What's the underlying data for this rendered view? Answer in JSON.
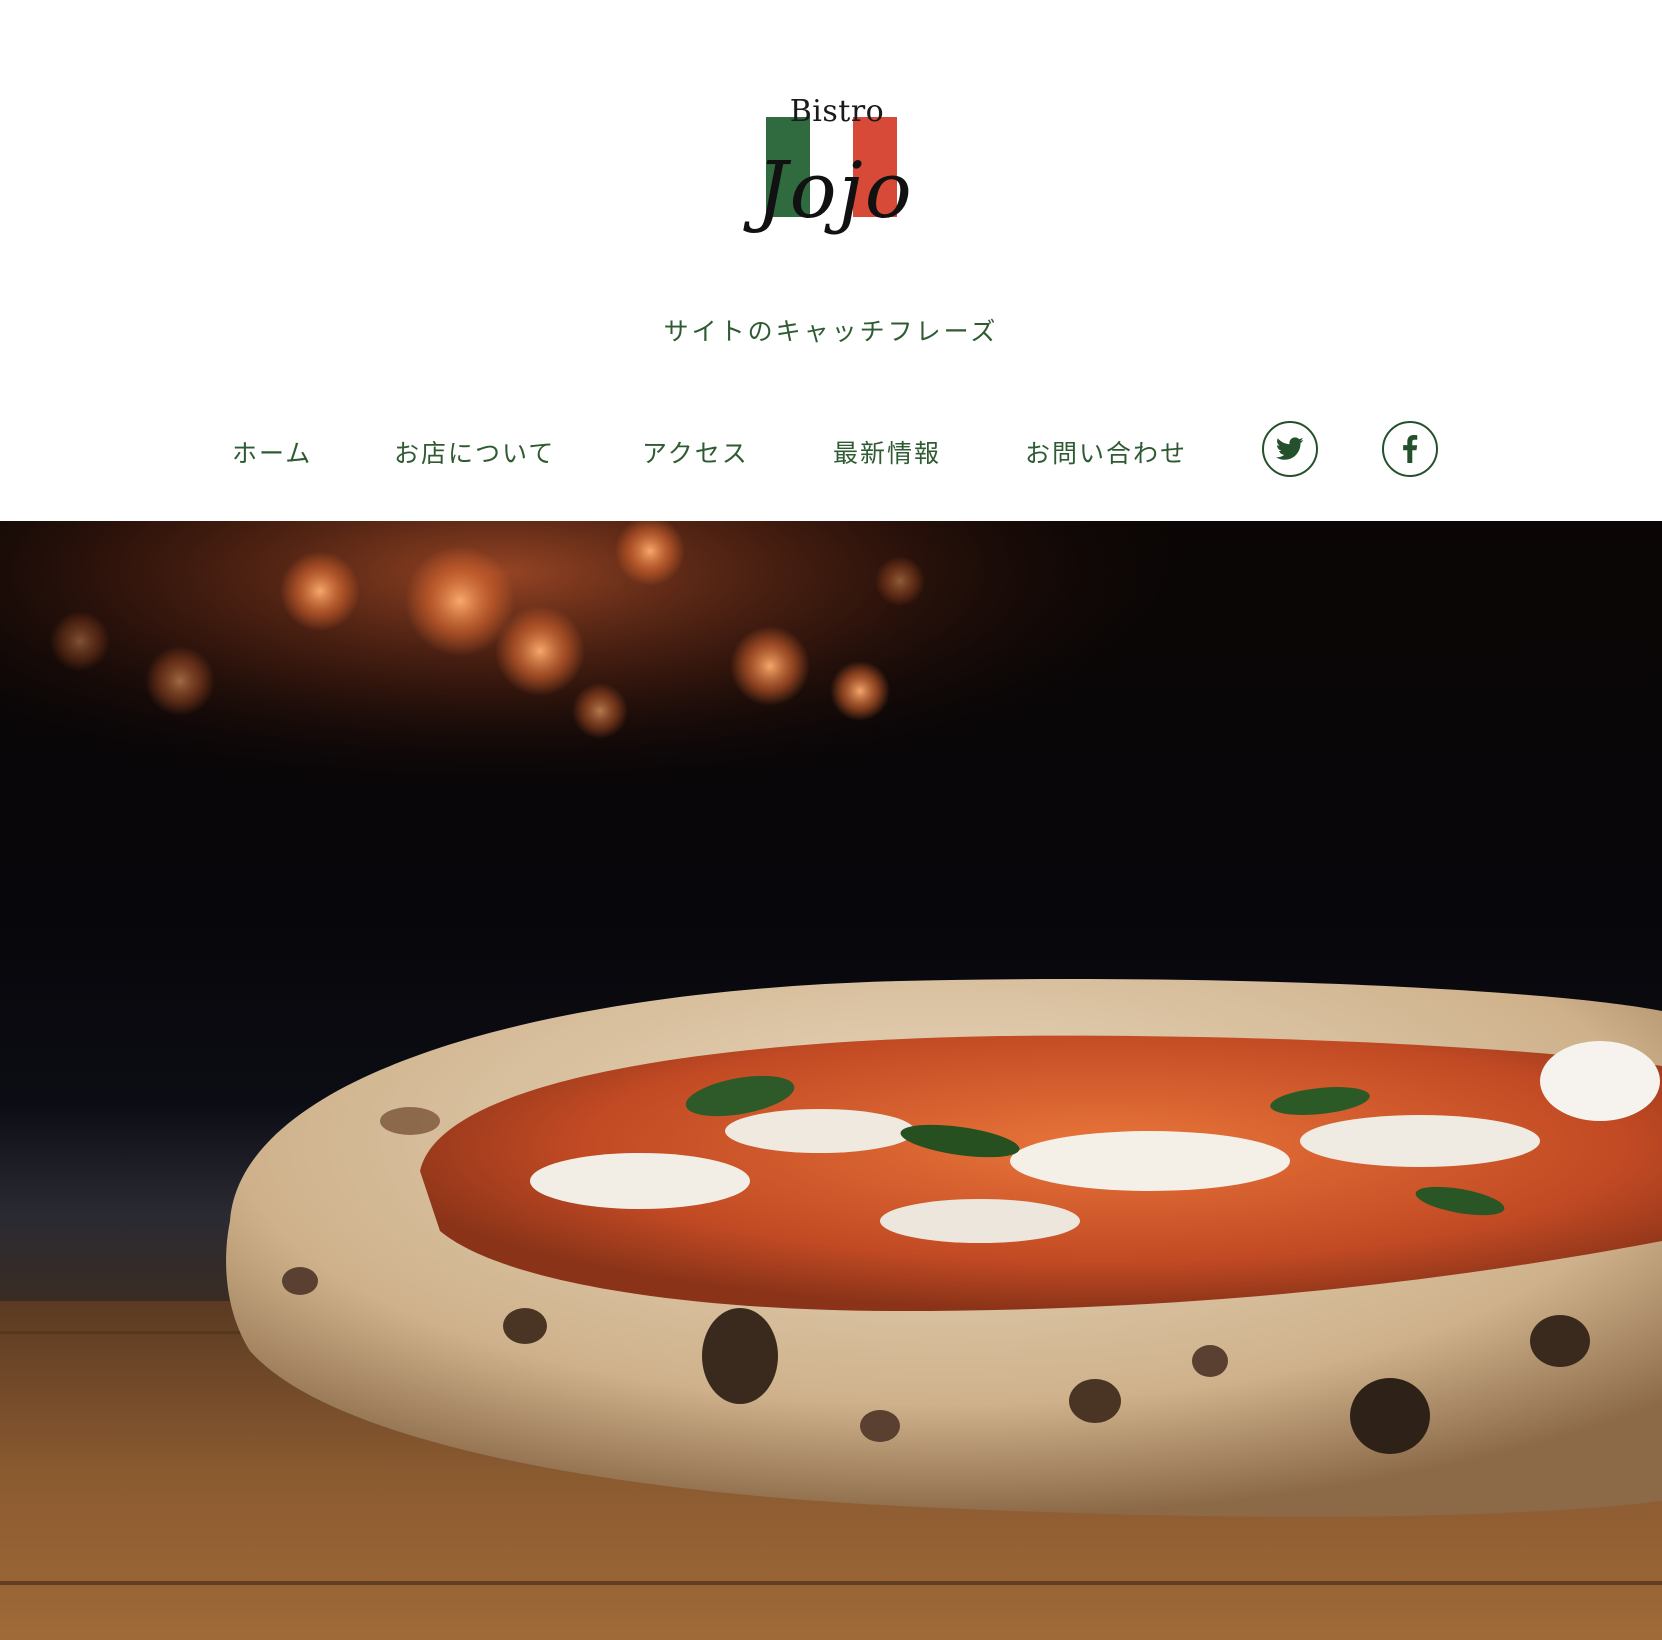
{
  "header": {
    "logo": {
      "small_word": "Bistro",
      "main_word": "Jojo",
      "flag_colors": {
        "green": "#2f6b3f",
        "red": "#d84a38"
      }
    },
    "tagline": "サイトのキャッチフレーズ"
  },
  "nav": {
    "items": [
      {
        "label": "ホーム"
      },
      {
        "label": "お店について"
      },
      {
        "label": "アクセス"
      },
      {
        "label": "最新情報"
      },
      {
        "label": "お問い合わせ"
      }
    ],
    "social": [
      {
        "icon": "twitter-icon"
      },
      {
        "icon": "facebook-icon"
      }
    ]
  },
  "hero": {
    "image": "pizza-photo",
    "colors": {
      "text_green": "#2f5b33",
      "social_border": "#24502b"
    }
  }
}
